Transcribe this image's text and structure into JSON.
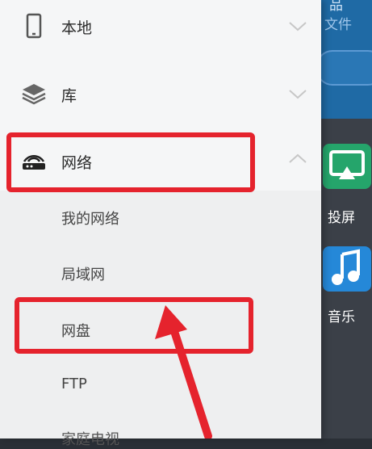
{
  "background": {
    "header_text_1": "品",
    "header_text_2": "文件",
    "tiles": [
      {
        "label": "投屏",
        "color": "#25a56b"
      },
      {
        "label": "音乐",
        "color": "#2588d8"
      }
    ]
  },
  "drawer": {
    "items": [
      {
        "label": "本地",
        "icon": "phone-icon",
        "expanded": false
      },
      {
        "label": "库",
        "icon": "layers-icon",
        "expanded": false
      },
      {
        "label": "网络",
        "icon": "router-icon",
        "expanded": true
      }
    ],
    "network_submenu": [
      "我的网络",
      "局域网",
      "网盘",
      "FTP",
      "家庭电视"
    ]
  },
  "annotation_color": "#e5232d"
}
